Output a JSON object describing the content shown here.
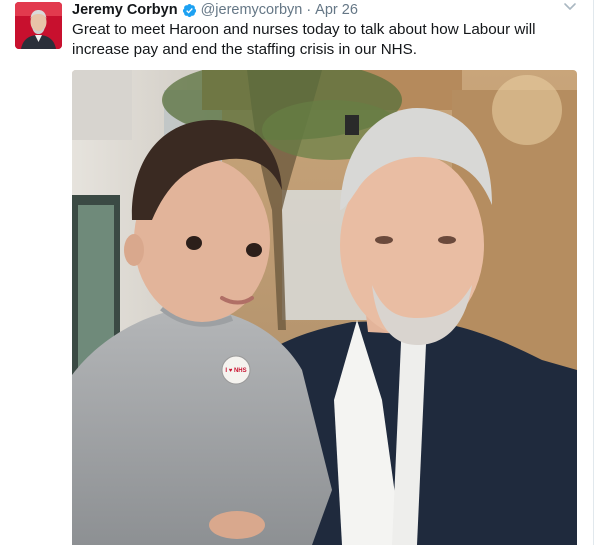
{
  "tweet": {
    "author_name": "Jeremy Corbyn",
    "author_handle": "@jeremycorbyn",
    "separator": "·",
    "timestamp": "Apr 26",
    "text": "Great to meet Haroon and nurses today to talk about how Labour will increase pay and end the staffing crisis in our NHS.",
    "badge_text": "I ♥ NHS"
  },
  "icons": {
    "verified": "verified-badge-icon",
    "caret": "chevron-down-icon"
  },
  "colors": {
    "verified_blue": "#1da1f2",
    "secondary_text": "#657786",
    "primary_text": "#14171a",
    "avatar_bg": "#c8102e"
  }
}
